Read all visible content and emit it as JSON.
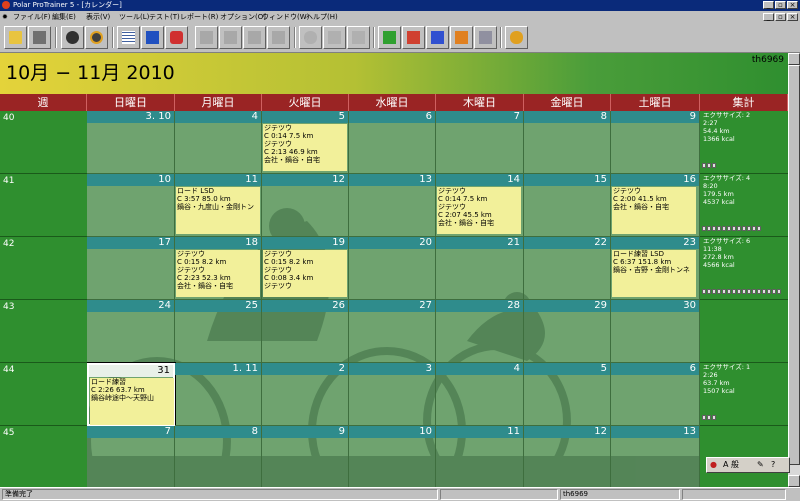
{
  "window": {
    "title": "Polar ProTrainer 5 - [カレンダー]"
  },
  "menu": [
    {
      "label": "ファイル(F)"
    },
    {
      "label": "編集(E)"
    },
    {
      "label": "表示(V)"
    },
    {
      "label": "ツール(L)"
    },
    {
      "label": "テスト(T)"
    },
    {
      "label": "レポート(R)"
    },
    {
      "label": "オプション(O)"
    },
    {
      "label": "ウィンドウ(W)"
    },
    {
      "label": "ヘルプ(H)"
    }
  ],
  "header": {
    "period": "10月 − 11月 2010",
    "user": "th6969"
  },
  "columns": {
    "week": "週",
    "days": [
      "日曜日",
      "月曜日",
      "火曜日",
      "水曜日",
      "木曜日",
      "金曜日",
      "土曜日"
    ],
    "summary": "集計"
  },
  "weeks": [
    {
      "num": "40",
      "days": [
        {
          "d": "3. 10",
          "ev": []
        },
        {
          "d": "4",
          "ev": []
        },
        {
          "d": "5",
          "ev": [
            "ジテツウ",
            "C 0:14 7.5 km",
            "ジテツウ",
            "C 2:13 46.9 km",
            "会社・鍋谷・自宅"
          ]
        },
        {
          "d": "6",
          "ev": []
        },
        {
          "d": "7",
          "ev": []
        },
        {
          "d": "8",
          "ev": []
        },
        {
          "d": "9",
          "ev": []
        }
      ]
    },
    {
      "num": "41",
      "days": [
        {
          "d": "10",
          "ev": []
        },
        {
          "d": "11",
          "ev": [
            "ロード LSD",
            "C 3:57 85.0 km",
            "鍋谷・九度山・金剛トン"
          ]
        },
        {
          "d": "12",
          "ev": []
        },
        {
          "d": "13",
          "ev": []
        },
        {
          "d": "14",
          "ev": [
            "ジテツウ",
            "C 0:14 7.5 km",
            "ジテツウ",
            "C 2:07 45.5 km",
            "会社・鍋谷・自宅"
          ]
        },
        {
          "d": "15",
          "ev": []
        },
        {
          "d": "16",
          "ev": [
            "ジテツウ",
            "C 2:00 41.5 km",
            "会社・鍋谷・自宅"
          ]
        }
      ]
    },
    {
      "num": "42",
      "days": [
        {
          "d": "17",
          "ev": []
        },
        {
          "d": "18",
          "ev": [
            "ジテツウ",
            "C 0:15 8.2 km",
            "ジテツウ",
            "C 2:23 52.3 km",
            "会社・鍋谷・自宅"
          ]
        },
        {
          "d": "19",
          "ev": [
            "ジテツウ",
            "C 0:15 8.2 km",
            "ジテツウ",
            "C 0:08 3.4 km",
            "ジテツウ"
          ]
        },
        {
          "d": "20",
          "ev": []
        },
        {
          "d": "21",
          "ev": []
        },
        {
          "d": "22",
          "ev": []
        },
        {
          "d": "23",
          "ev": [
            "ロード練習 LSD",
            "C 6:37 151.8 km",
            "鍋谷・吉野・金剛トンネ"
          ]
        }
      ]
    },
    {
      "num": "43",
      "days": [
        {
          "d": "24",
          "ev": []
        },
        {
          "d": "25",
          "ev": []
        },
        {
          "d": "26",
          "ev": []
        },
        {
          "d": "27",
          "ev": []
        },
        {
          "d": "28",
          "ev": []
        },
        {
          "d": "29",
          "ev": []
        },
        {
          "d": "30",
          "ev": []
        }
      ]
    },
    {
      "num": "44",
      "days": [
        {
          "d": "31",
          "ev": [
            "ロード練習",
            "C 2:26 63.7 km",
            "鍋谷峠途中〜天野山"
          ]
        },
        {
          "d": "1. 11",
          "ev": []
        },
        {
          "d": "2",
          "ev": []
        },
        {
          "d": "3",
          "ev": []
        },
        {
          "d": "4",
          "ev": []
        },
        {
          "d": "5",
          "ev": []
        },
        {
          "d": "6",
          "ev": []
        }
      ]
    },
    {
      "num": "45",
      "days": [
        {
          "d": "7",
          "ev": []
        },
        {
          "d": "8",
          "ev": []
        },
        {
          "d": "9",
          "ev": []
        },
        {
          "d": "10",
          "ev": []
        },
        {
          "d": "11",
          "ev": []
        },
        {
          "d": "12",
          "ev": []
        },
        {
          "d": "13",
          "ev": []
        }
      ]
    }
  ],
  "summaries": [
    {
      "lines": [
        "エクササイズ: 2",
        "2:27",
        "54.4 km",
        "1366 kcal"
      ],
      "bar": 3
    },
    {
      "lines": [
        "エクササイズ: 4",
        "8:20",
        "179.5 km",
        "4537 kcal"
      ],
      "bar": 12
    },
    {
      "lines": [
        "エクササイズ: 6",
        "11:38",
        "272.8 km",
        "4566 kcal"
      ],
      "bar": 16
    },
    {
      "lines": [],
      "bar": 0
    },
    {
      "lines": [
        "エクササイズ: 1",
        "2:26",
        "63.7 km",
        "1507 kcal"
      ],
      "bar": 3
    },
    {
      "lines": [],
      "bar": 0
    }
  ],
  "ime": {
    "mode": "A 般"
  },
  "status": {
    "ready": "準備完了",
    "user": "th6969"
  },
  "colors": {
    "strip": "#2f8c8c",
    "event": "#f2f09a",
    "header": "#9a2424",
    "weekcol": "#2f8f2f"
  }
}
